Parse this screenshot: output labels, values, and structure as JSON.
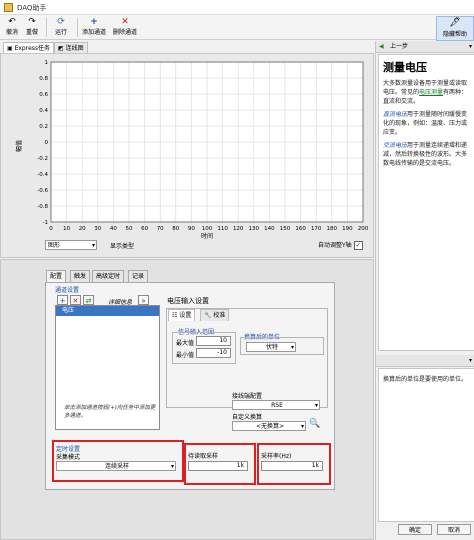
{
  "window": {
    "title": "DAQ助手"
  },
  "toolbar": {
    "undo": "撤消",
    "redo": "重做",
    "run": "运行",
    "add_channel": "添加通道",
    "remove_channel": "删除通道",
    "hide_help": "隐藏帮助"
  },
  "top_tabs": [
    "Express任务",
    "连线图"
  ],
  "chart_data": {
    "type": "line",
    "title": "",
    "xlabel": "时间",
    "ylabel": "幅值",
    "xlim": [
      0,
      200
    ],
    "ylim": [
      -1,
      1
    ],
    "x_ticks": [
      0,
      10,
      20,
      30,
      40,
      50,
      60,
      70,
      80,
      90,
      100,
      110,
      120,
      130,
      140,
      150,
      160,
      170,
      180,
      190,
      200
    ],
    "y_ticks": [
      -1,
      -0.8,
      -0.6,
      -0.4,
      -0.2,
      0,
      0.2,
      0.4,
      0.6,
      0.8,
      1
    ],
    "x_tick_labels": [
      "0",
      "10",
      "20",
      "30",
      "40",
      "50",
      "60",
      "70",
      "80",
      "90",
      "100",
      "110",
      "120",
      "130",
      "140",
      "150",
      "160",
      "170",
      "180",
      "190",
      "200"
    ],
    "y_tick_labels": [
      "-1",
      "-0.8",
      "-0.6",
      "-0.4",
      "-0.2",
      "0",
      "0.2",
      "0.4",
      "0.6",
      "0.8",
      "1"
    ],
    "grid": true,
    "series": []
  },
  "below_chart": {
    "graph_type": "图形",
    "display_type_label": "显示类型",
    "autoscale_label": "自动调整Y轴"
  },
  "config": {
    "tabs": [
      "配置",
      "触发",
      "高级定时",
      "记录"
    ],
    "channel_settings_title": "通道设置",
    "details_label": "详细信息",
    "channel_name": "电压",
    "list_hint": "单击添加通道按钮(+)向任务中添加更多通道。",
    "voltage_input_title": "电压输入设置",
    "sub_tabs": [
      "设置",
      "校准"
    ],
    "signal_range_title": "信号输入范围",
    "max_label": "最大值",
    "max_value": "10",
    "min_label": "最小值",
    "min_value": "-10",
    "scaled_units_title": "换算后的单位",
    "scaled_units_value": "伏特",
    "terminal_config_label": "接线端配置",
    "terminal_config_value": "RSE",
    "custom_scale_label": "自定义换算",
    "custom_scale_value": "<无换算>",
    "timing_title": "定时设置",
    "acq_mode_label": "采集模式",
    "acq_mode_value": "连续采样",
    "samples_label": "待读取采样",
    "samples_value": "1k",
    "rate_label": "采样率(Hz)",
    "rate_value": "1k"
  },
  "help": {
    "back_label": "上一步",
    "title": "测量电压",
    "p1_pre": "大多数测量设备用于测量或读取电压。常见的",
    "p1_link": "电压测量",
    "p1_post": "有两种：直流和交流。",
    "p2_em": "直流电压",
    "p2": "用于测量随时间缓慢变化的现象，例如：温度、压力或应变。",
    "p3_em": "交流电压",
    "p3": "用于测量连续递增和递减，然后转换极性的波形。大多数电线传输的是交流电压。",
    "lower_text": "换算后的单位是要使用的单位。"
  },
  "footer": {
    "ok": "确定",
    "cancel": "取消"
  },
  "colors": {
    "highlight": "#e02020",
    "selection": "#3a74c6",
    "link": "#1a7a2a"
  }
}
